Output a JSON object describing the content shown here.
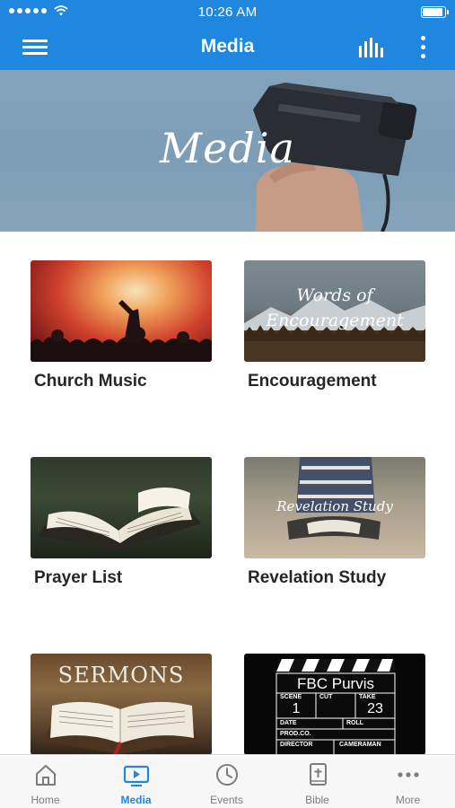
{
  "status_bar": {
    "time": "10:26 AM"
  },
  "app_bar": {
    "title": "Media"
  },
  "hero": {
    "title": "Media"
  },
  "tiles": [
    {
      "label": "Church Music"
    },
    {
      "label": "Encouragement",
      "overlay_line1": "Words of",
      "overlay_line2": "Encouragement"
    },
    {
      "label": "Prayer List"
    },
    {
      "label": "Revelation Study",
      "overlay": "Revelation Study"
    },
    {
      "label": "",
      "overlay": "SERMONS"
    },
    {
      "label": "",
      "board_title": "FBC Purvis",
      "scene_label": "SCENE",
      "scene": "1",
      "cut_label": "CUT",
      "take_label": "TAKE",
      "take": "23",
      "date_label": "DATE",
      "roll_label": "ROLL",
      "prod_label": "PROD.CO.",
      "director_label": "DIRECTOR",
      "camera_label": "CAMERAMAN"
    }
  ],
  "tab_bar": {
    "active": "Media",
    "tabs": [
      {
        "label": "Home",
        "icon": "home-icon"
      },
      {
        "label": "Media",
        "icon": "tv-icon"
      },
      {
        "label": "Events",
        "icon": "clock-icon"
      },
      {
        "label": "Bible",
        "icon": "bible-icon"
      },
      {
        "label": "More",
        "icon": "more-icon"
      }
    ]
  },
  "colors": {
    "brand": "#1f87e0",
    "tab_inactive": "#7c7c7c",
    "text": "#262626"
  }
}
